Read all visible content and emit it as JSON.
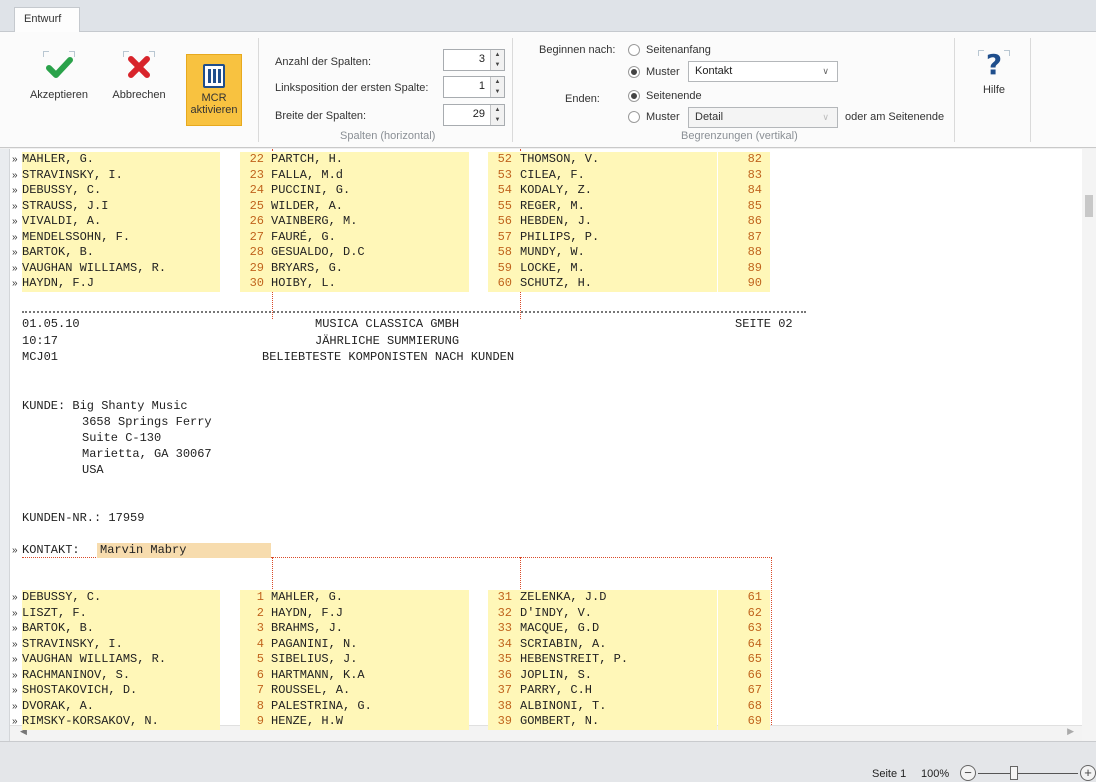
{
  "ribbon": {
    "tab": "Entwurf",
    "buttons": {
      "accept": "Akzeptieren",
      "cancel": "Abbrechen",
      "mcr_line1": "MCR",
      "mcr_line2": "aktivieren",
      "help": "Hilfe"
    },
    "columns_group": {
      "label": "Spalten (horizontal)",
      "count_label": "Anzahl der Spalten:",
      "count_value": "3",
      "left_label": "Linksposition der ersten Spalte:",
      "left_value": "1",
      "width_label": "Breite der Spalten:",
      "width_value": "29"
    },
    "limits_group": {
      "label": "Begrenzungen (vertikal)",
      "begin_label": "Beginnen nach:",
      "begin_opt1": "Seitenanfang",
      "begin_opt2": "Muster",
      "begin_combo": "Kontakt",
      "end_label": "Enden:",
      "end_opt1": "Seitenende",
      "end_opt2": "Muster",
      "end_combo": "Detail",
      "end_suffix": "oder am Seitenende"
    }
  },
  "document": {
    "top_rows": [
      {
        "c1": "MAHLER, G.",
        "n1": "22",
        "c2": "PARTCH, H.",
        "n2": "52",
        "c3": "THOMSON, V.",
        "n3": "82"
      },
      {
        "c1": "STRAVINSKY, I.",
        "n1": "23",
        "c2": "FALLA, M.d",
        "n2": "53",
        "c3": "CILEA, F.",
        "n3": "83"
      },
      {
        "c1": "DEBUSSY, C.",
        "n1": "24",
        "c2": "PUCCINI, G.",
        "n2": "54",
        "c3": "KODALY, Z.",
        "n3": "84"
      },
      {
        "c1": "STRAUSS, J.I",
        "n1": "25",
        "c2": "WILDER, A.",
        "n2": "55",
        "c3": "REGER, M.",
        "n3": "85"
      },
      {
        "c1": "VIVALDI, A.",
        "n1": "26",
        "c2": "VAINBERG, M.",
        "n2": "56",
        "c3": "HEBDEN, J.",
        "n3": "86"
      },
      {
        "c1": "MENDELSSOHN, F.",
        "n1": "27",
        "c2": "FAURÉ, G.",
        "n2": "57",
        "c3": "PHILIPS, P.",
        "n3": "87"
      },
      {
        "c1": "BARTOK, B.",
        "n1": "28",
        "c2": "GESUALDO, D.C",
        "n2": "58",
        "c3": "MUNDY, W.",
        "n3": "88"
      },
      {
        "c1": "VAUGHAN WILLIAMS, R.",
        "n1": "29",
        "c2": "BRYARS, G.",
        "n2": "59",
        "c3": "LOCKE, M.",
        "n3": "89"
      },
      {
        "c1": "HAYDN, F.J",
        "n1": "30",
        "c2": "HOIBY, L.",
        "n2": "60",
        "c3": "SCHUTZ, H.",
        "n3": "90"
      }
    ],
    "header": {
      "date": "01.05.10",
      "company": "MUSICA CLASSICA GMBH",
      "page": "SEITE 02",
      "time": "10:17",
      "summary": "JÄHRLICHE SUMMIERUNG",
      "code": "MCJ01",
      "report_title": "BELIEBTESTE KOMPONISTEN NACH KUNDEN"
    },
    "customer": {
      "line1": "KUNDE: Big Shanty Music",
      "line2": "3658 Springs Ferry",
      "line3": "Suite C-130",
      "line4": "Marietta, GA 30067",
      "line5": "USA",
      "number": "KUNDEN-NR.: 17959",
      "contact_label": "KONTAKT:",
      "contact_name": "Marvin Mabry"
    },
    "bottom_rows": [
      {
        "c1": "DEBUSSY, C.",
        "n1": "1",
        "c2": "MAHLER, G.",
        "n2": "31",
        "c3": "ZELENKA, J.D",
        "n3": "61"
      },
      {
        "c1": "LISZT, F.",
        "n1": "2",
        "c2": "HAYDN, F.J",
        "n2": "32",
        "c3": "D'INDY, V.",
        "n3": "62"
      },
      {
        "c1": "BARTOK, B.",
        "n1": "3",
        "c2": "BRAHMS, J.",
        "n2": "33",
        "c3": "MACQUE, G.D",
        "n3": "63"
      },
      {
        "c1": "STRAVINSKY, I.",
        "n1": "4",
        "c2": "PAGANINI, N.",
        "n2": "34",
        "c3": "SCRIABIN, A.",
        "n3": "64"
      },
      {
        "c1": "VAUGHAN WILLIAMS, R.",
        "n1": "5",
        "c2": "SIBELIUS, J.",
        "n2": "35",
        "c3": "HEBENSTREIT, P.",
        "n3": "65"
      },
      {
        "c1": "RACHMANINOV, S.",
        "n1": "6",
        "c2": "HARTMANN, K.A",
        "n2": "36",
        "c3": "JOPLIN, S.",
        "n3": "66"
      },
      {
        "c1": "SHOSTAKOVICH, D.",
        "n1": "7",
        "c2": "ROUSSEL, A.",
        "n2": "37",
        "c3": "PARRY, C.H",
        "n3": "67"
      },
      {
        "c1": "DVORAK, A.",
        "n1": "8",
        "c2": "PALESTRINA, G.",
        "n2": "38",
        "c3": "ALBINONI, T.",
        "n3": "68"
      },
      {
        "c1": "RIMSKY-KORSAKOV, N.",
        "n1": "9",
        "c2": "HENZE, H.W",
        "n2": "39",
        "c3": "GOMBERT, N.",
        "n3": "69"
      }
    ]
  },
  "status": {
    "page": "Seite 1",
    "zoom": "100%"
  },
  "colors": {
    "highlight": "#fff7b8",
    "contact_highlight": "#f7dcae",
    "number_color": "#c0641d",
    "mcr_active": "#f8c240"
  }
}
